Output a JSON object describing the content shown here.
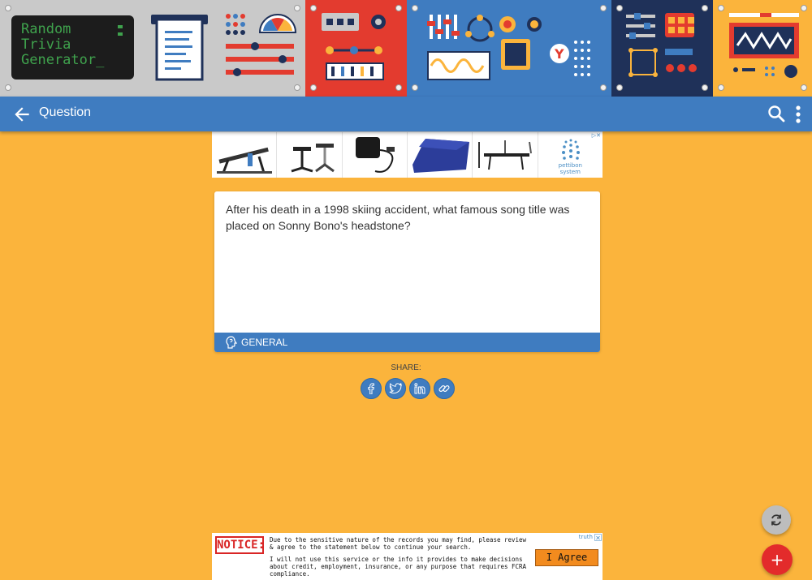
{
  "banner": {
    "terminal_lines": [
      "Random",
      "Trivia",
      "Generator_"
    ]
  },
  "appbar": {
    "title": "Question",
    "back_icon": "arrow-back-icon",
    "search_icon": "search-icon",
    "more_icon": "more-vert-icon"
  },
  "top_ad": {
    "brand_text": "pettibon\nsystem"
  },
  "question": {
    "text": "After his death in a 1998 skiing accident, what famous song title was placed on Sonny Bono's headstone?",
    "category": "GENERAL",
    "category_icon": "brain-head-icon"
  },
  "share": {
    "label": "SHARE:",
    "buttons": [
      "facebook-icon",
      "twitter-icon",
      "linkedin-icon",
      "link-icon"
    ]
  },
  "fabs": {
    "refresh_icon": "refresh-icon",
    "add_label": "+"
  },
  "notice_ad": {
    "title": "NOTICE:",
    "text1": "Due to the sensitive nature of the records you may find, please review & agree to the statement below to continue your search.",
    "text2": "I will not use this service or the info it provides to make decisions about credit, employment, insurance, or any purpose that requires FCRA compliance.",
    "agree_label": "I Agree",
    "ad_choice_label": "truth"
  },
  "colors": {
    "background": "#fbb43c",
    "primary_blue": "#3f7cc0",
    "accent_red": "#e32b2b",
    "terminal_green": "#3fa24d"
  }
}
